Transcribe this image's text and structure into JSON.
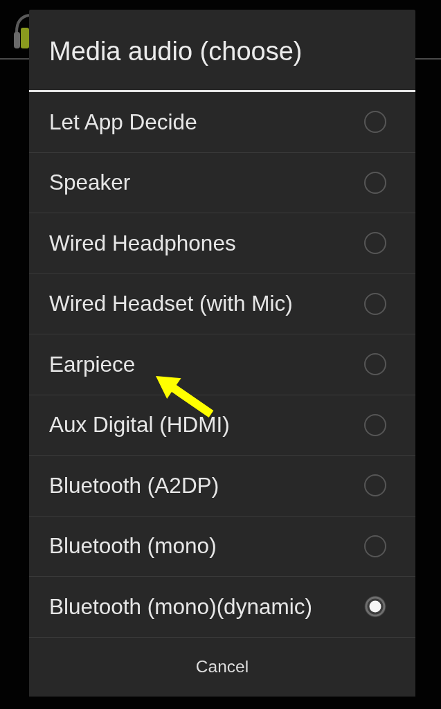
{
  "dialog": {
    "title": "Media audio (choose)",
    "options": [
      {
        "label": "Let App Decide",
        "selected": false
      },
      {
        "label": "Speaker",
        "selected": false
      },
      {
        "label": "Wired Headphones",
        "selected": false
      },
      {
        "label": "Wired Headset (with Mic)",
        "selected": false
      },
      {
        "label": "Earpiece",
        "selected": false
      },
      {
        "label": "Aux Digital (HDMI)",
        "selected": false
      },
      {
        "label": "Bluetooth (A2DP)",
        "selected": false
      },
      {
        "label": "Bluetooth (mono)",
        "selected": false
      },
      {
        "label": "Bluetooth (mono)(dynamic)",
        "selected": true
      }
    ],
    "cancel_button": "Cancel"
  },
  "annotations": [
    {
      "kind": "arrow"
    }
  ]
}
